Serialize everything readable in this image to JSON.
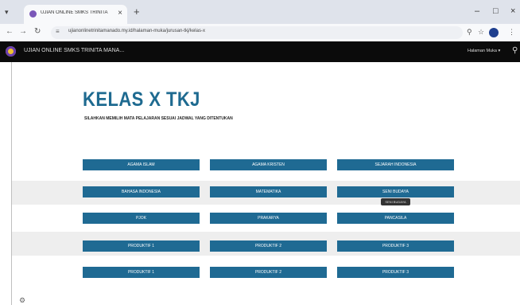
{
  "browser": {
    "tab_title": "UJIAN ONLINE SMKS TRINITA MANA",
    "url": "ujianonlinetrinitamanado.my.id/halaman-muka/jurusan-tkj/kelas-x"
  },
  "site": {
    "title": "UJIAN ONLINE SMKS TRINITA MANA...",
    "home_menu": "Halaman Muka"
  },
  "page": {
    "title": "KELAS X TKJ",
    "subtitle": "SILAHKAN MEMILIH MATA PELAJARAN SESUAI JADWAL YANG DITENTUKAN"
  },
  "subjects": [
    [
      "AGAMA ISLAM",
      "AGAMA KRISTEN",
      "SEJARAH INDONESIA"
    ],
    [
      "BAHASA INDONESIA",
      "MATEMATIKA",
      "SENI BUDAYA"
    ],
    [
      "PJOK",
      "PRAKARYA",
      "PANCASILA"
    ],
    [
      "PRODUKTIF 1",
      "PRODUKTIF 2",
      "PRODUKTIF 3"
    ],
    [
      "PRODUKTIF 1",
      "PRODUKTIF 2",
      "PRODUKTIF 3"
    ]
  ],
  "tooltip": "SENI BUDAYA",
  "colors": {
    "button": "#1f6a93",
    "title": "#1e6a90",
    "header_bg": "#0b0b0b",
    "row_band": "#eeeeee"
  }
}
